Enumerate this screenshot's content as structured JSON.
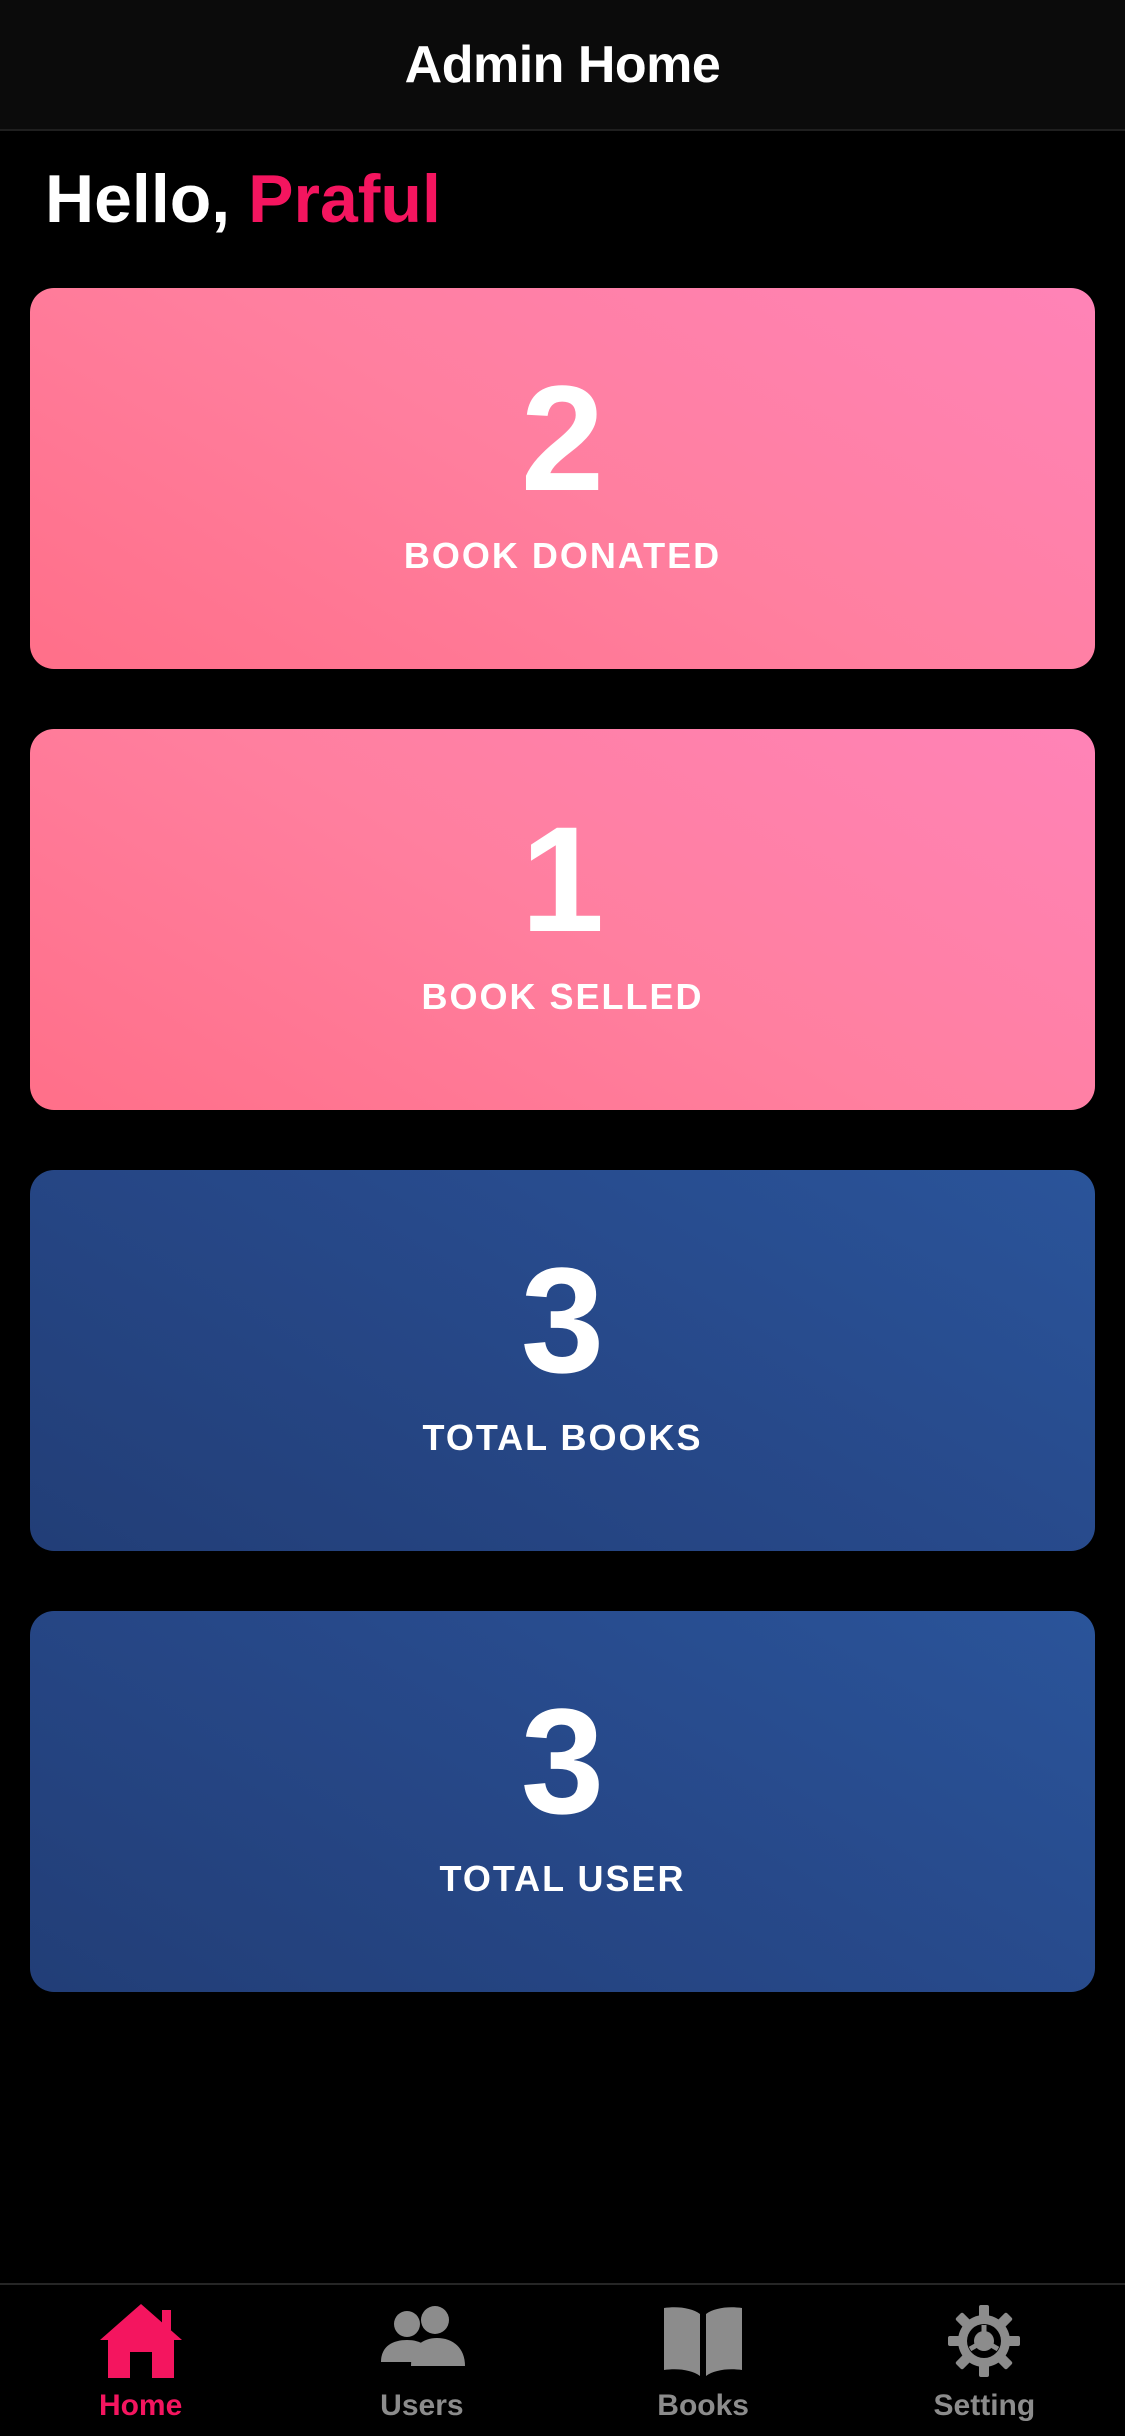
{
  "header": {
    "title": "Admin Home"
  },
  "greeting": {
    "hello": "Hello,",
    "name": "Praful"
  },
  "cards": [
    {
      "value": "2",
      "label": "BOOK DONATED",
      "theme": "pink"
    },
    {
      "value": "1",
      "label": "BOOK SELLED",
      "theme": "pink"
    },
    {
      "value": "3",
      "label": "TOTAL BOOKS",
      "theme": "blue"
    },
    {
      "value": "3",
      "label": "TOTAL USER",
      "theme": "blue"
    }
  ],
  "tabbar": {
    "items": [
      {
        "label": "Home",
        "icon": "home-icon",
        "active": true
      },
      {
        "label": "Users",
        "icon": "users-icon",
        "active": false
      },
      {
        "label": "Books",
        "icon": "book-icon",
        "active": false
      },
      {
        "label": "Setting",
        "icon": "gear-icon",
        "active": false
      }
    ]
  },
  "colors": {
    "accent": "#f4155f",
    "inactive": "#8c8c8c",
    "background": "#000000",
    "pink_card": "#ff7f9f",
    "blue_card": "#27498a"
  }
}
